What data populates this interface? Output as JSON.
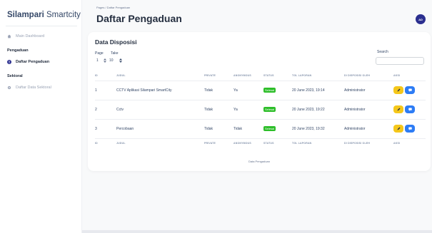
{
  "brand": {
    "bold": "Silampari",
    "light": " Smartcity"
  },
  "sidebar": {
    "main_dashboard": "Main Dashboard",
    "section_pengaduan": "Pengaduan",
    "daftar_pengaduan": "Daftar Pengaduan",
    "section_sektoral": "Sektoral",
    "daftar_data_sektoral": "Daftar Data Sektoral"
  },
  "header": {
    "breadcrumb": "Pages / Daftar Pengaduan",
    "title": "Daftar Pengaduan",
    "avatar_initials": "AD"
  },
  "card": {
    "title": "Data Disposisi",
    "page_label": "Page",
    "page_value": "1",
    "take_label": "Take",
    "take_value": "10",
    "search_label": "Search",
    "search_value": ""
  },
  "table": {
    "columns": [
      "ID",
      "JUDUL",
      "PRIVATE",
      "ANONYMOUS",
      "STATUS",
      "TGL LAPORAN",
      "DI DISPOSISI OLEH",
      "AKSI"
    ],
    "rows": [
      {
        "id": "1",
        "judul": "CCTV Aplikasi Silampari SmartCity",
        "private": "Tidak",
        "anonymous": "Ya",
        "status": "Selesai",
        "tgl": "20 June 2023, 19:14",
        "oleh": "Administrator"
      },
      {
        "id": "2",
        "judul": "Cctv",
        "private": "Tidak",
        "anonymous": "Ya",
        "status": "Selesai",
        "tgl": "20 June 2023, 19:22",
        "oleh": "Administrator"
      },
      {
        "id": "3",
        "judul": "Percobaan",
        "private": "Tidak",
        "anonymous": "Tidak",
        "status": "Selesai",
        "tgl": "20 June 2023, 19:32",
        "oleh": "Administrator"
      }
    ],
    "caption": "Data Pengaduan"
  },
  "colors": {
    "accent": "#2b2f8f",
    "status_done": "#2dbe29",
    "edit": "#f5c71a",
    "view": "#2d7cf5"
  },
  "icons": {
    "dashboard": "house-icon",
    "pengaduan": "exclamation-icon",
    "sektoral": "gear-icon",
    "edit": "pencil-icon",
    "view": "chat-icon",
    "stepper": "chevron-updown-icon"
  }
}
